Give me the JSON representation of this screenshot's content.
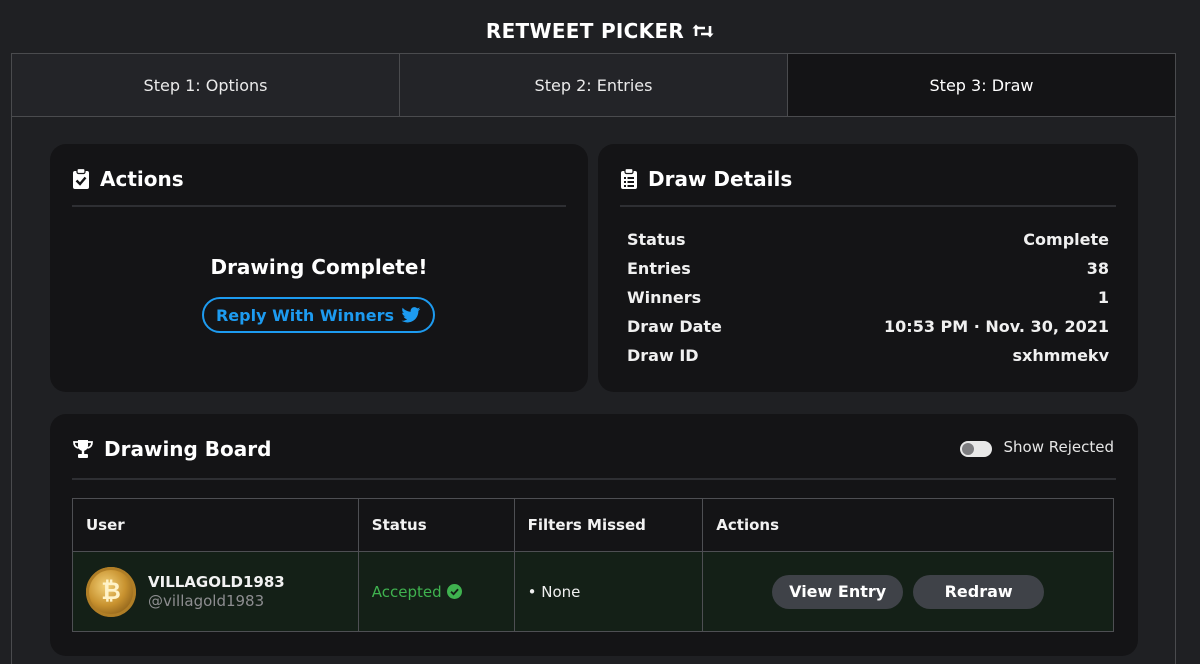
{
  "app": {
    "title": "RETWEET PICKER",
    "title_icon": "retweet-icon"
  },
  "tabs": [
    {
      "label": "Step 1: Options",
      "active": false
    },
    {
      "label": "Step 2: Entries",
      "active": false
    },
    {
      "label": "Step 3: Draw",
      "active": true
    }
  ],
  "actions": {
    "title": "Actions",
    "icon": "clipboard-check-icon",
    "message": "Drawing Complete!",
    "reply_button": "Reply With Winners",
    "reply_icon": "twitter-bird-icon"
  },
  "details": {
    "title": "Draw Details",
    "icon": "clipboard-list-icon",
    "rows": [
      {
        "label": "Status",
        "value": "Complete"
      },
      {
        "label": "Entries",
        "value": "38"
      },
      {
        "label": "Winners",
        "value": "1"
      },
      {
        "label": "Draw Date",
        "value": "10:53 PM · Nov. 30, 2021"
      },
      {
        "label": "Draw ID",
        "value": "sxhmmekv"
      }
    ]
  },
  "board": {
    "title": "Drawing Board",
    "icon": "trophy-icon",
    "toggle_label": "Show Rejected",
    "toggle_on": false,
    "columns": [
      "User",
      "Status",
      "Filters Missed",
      "Actions"
    ],
    "rows": [
      {
        "display_name": "VILLAGOLD1983",
        "handle": "@villagold1983",
        "status": "Accepted",
        "filters_missed": "• None",
        "view_button": "View Entry",
        "redraw_button": "Redraw"
      }
    ]
  },
  "colors": {
    "background": "#1f2023",
    "card": "#141416",
    "accent": "#1d9bf0",
    "accepted": "#3fb24f",
    "row_highlight": "#142017"
  }
}
